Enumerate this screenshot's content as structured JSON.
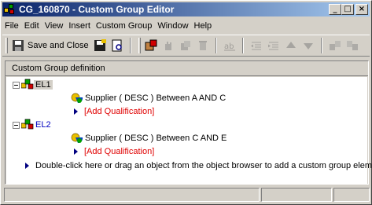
{
  "window": {
    "title": "CG_160870 - Custom Group Editor"
  },
  "title_buttons": {
    "minimize": "_",
    "maximize": "□",
    "close": "×"
  },
  "menu": [
    {
      "label": "File"
    },
    {
      "label": "Edit"
    },
    {
      "label": "View"
    },
    {
      "label": "Insert"
    },
    {
      "label": "Custom Group"
    },
    {
      "label": "Window"
    },
    {
      "label": "Help"
    }
  ],
  "toolbar": {
    "save_close_label": "Save and Close"
  },
  "panel": {
    "header": "Custom Group definition"
  },
  "tree": {
    "elements": [
      {
        "name": "EL1",
        "condition": "Supplier ( DESC )  Between A AND C",
        "add_qualification": "[Add Qualification]"
      },
      {
        "name": "EL2",
        "condition": "Supplier ( DESC )  Between C AND E",
        "add_qualification": "[Add Qualification]"
      }
    ],
    "hint": "Double-click here or drag an object from the object browser to add a custom group element."
  },
  "colors": {
    "title_start": "#0a246a",
    "title_end": "#a6caf0",
    "qualification_red": "#e00000",
    "element_blue": "#0000c0"
  }
}
